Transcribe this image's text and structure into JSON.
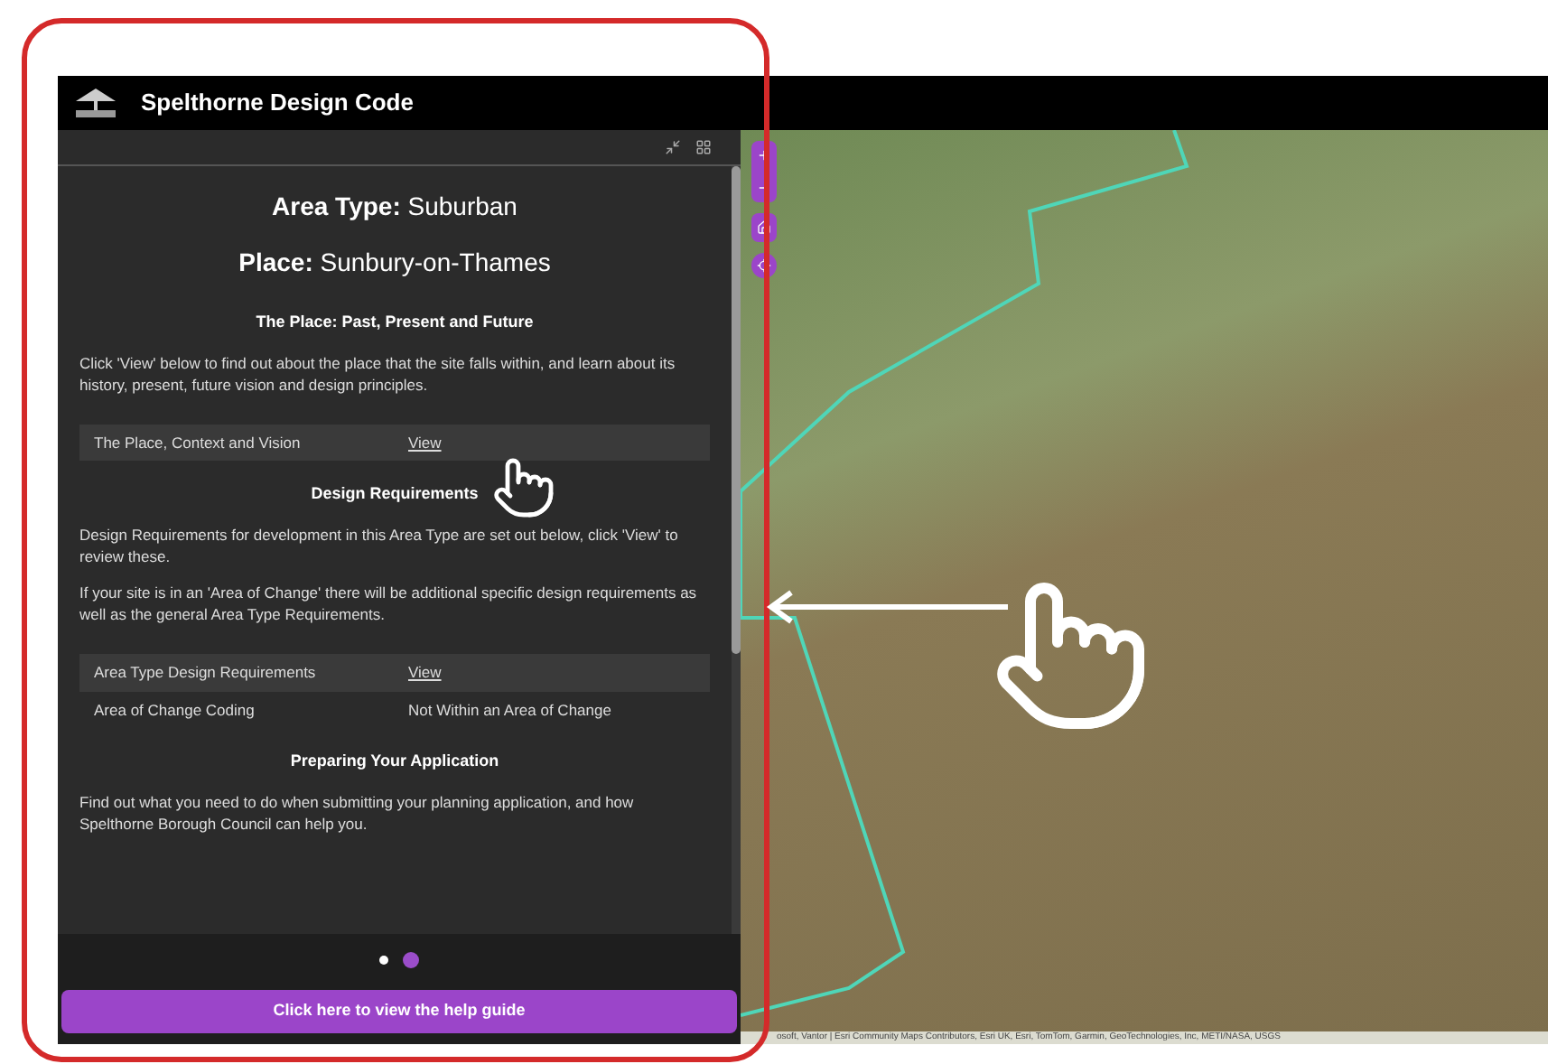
{
  "app": {
    "title": "Spelthorne Design Code"
  },
  "panel": {
    "area_type": "**Area Type:** Suburban",
    "place": "**Place:** Sunbury-on-Thames",
    "sections": [
      {
        "heading": "The Place: Past, Present and Future",
        "paragraphs": [
          "Click 'View' below to find out about the place that the site falls within, and learn about its history, present, future vision and design principles."
        ],
        "rows": [
          {
            "label": "The Place, Context and Vision",
            "value": "View",
            "kind": "link"
          }
        ]
      },
      {
        "heading": "Design Requirements",
        "paragraphs": [
          "Design Requirements for development in this Area Type are set out below, click 'View' to review these.",
          "If your site is in an 'Area of Change' there will be additional specific design requirements as well as the general Area Type Requirements."
        ],
        "rows": [
          {
            "label": "Area Type Design Requirements",
            "value": "View",
            "kind": "link"
          },
          {
            "label": "Area of Change Coding",
            "value": "Not Within an Area of Change",
            "kind": "text"
          }
        ]
      },
      {
        "heading": "Preparing Your Application",
        "paragraphs": [
          "Find out what you need to do when submitting your planning application, and how Spelthorne Borough Council can help you."
        ]
      }
    ]
  },
  "pager": {
    "dots": [
      {
        "selected": false
      },
      {
        "selected": true
      }
    ]
  },
  "help_button": "Click here to view the help guide",
  "map": {
    "attribution": "osoft, Vantor | Esri Community Maps Contributors, Esri UK, Esri, TomTom, Garmin, GeoTechnologies, Inc, METI/NASA, USGS"
  }
}
